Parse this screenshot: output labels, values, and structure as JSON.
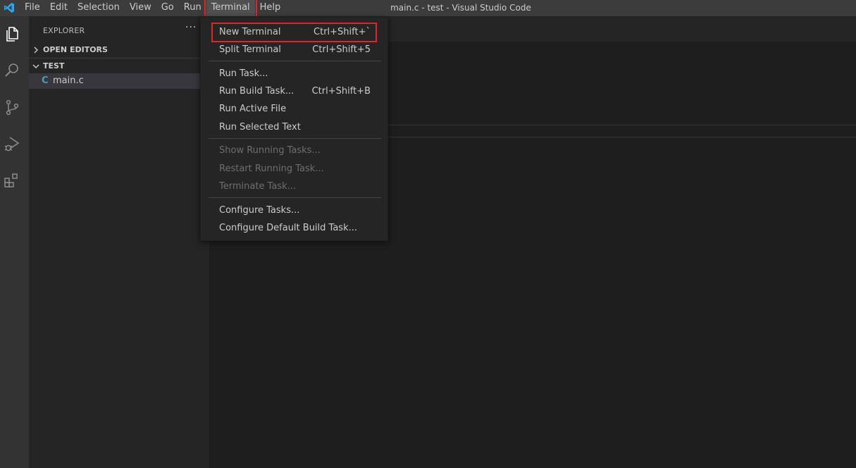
{
  "window": {
    "title": "main.c - test - Visual Studio Code"
  },
  "menubar": {
    "items": [
      "File",
      "Edit",
      "Selection",
      "View",
      "Go",
      "Run",
      "Terminal",
      "Help"
    ]
  },
  "activitybar": {
    "icons": [
      "files-icon",
      "search-icon",
      "source-control-icon",
      "run-debug-icon",
      "extensions-icon"
    ]
  },
  "sidebar": {
    "title": "EXPLORER",
    "more": "···",
    "open_editors_label": "OPEN EDITORS",
    "folder_label": "TEST",
    "file": {
      "icon_letter": "C",
      "name": "main.c"
    }
  },
  "terminal_menu": {
    "items": [
      {
        "label": "New Terminal",
        "shortcut": "Ctrl+Shift+`"
      },
      {
        "label": "Split Terminal",
        "shortcut": "Ctrl+Shift+5"
      },
      {
        "label": "Run Task...",
        "shortcut": ""
      },
      {
        "label": "Run Build Task...",
        "shortcut": "Ctrl+Shift+B"
      },
      {
        "label": "Run Active File",
        "shortcut": ""
      },
      {
        "label": "Run Selected Text",
        "shortcut": ""
      },
      {
        "label": "Show Running Tasks...",
        "shortcut": ""
      },
      {
        "label": "Restart Running Task...",
        "shortcut": ""
      },
      {
        "label": "Terminate Task...",
        "shortcut": ""
      },
      {
        "label": "Configure Tasks...",
        "shortcut": ""
      },
      {
        "label": "Configure Default Build Task...",
        "shortcut": ""
      }
    ]
  },
  "colors": {
    "accent_vscode_blue": "#23a9f2",
    "highlight_red": "#e0242b",
    "c_file_icon": "#519aba"
  }
}
